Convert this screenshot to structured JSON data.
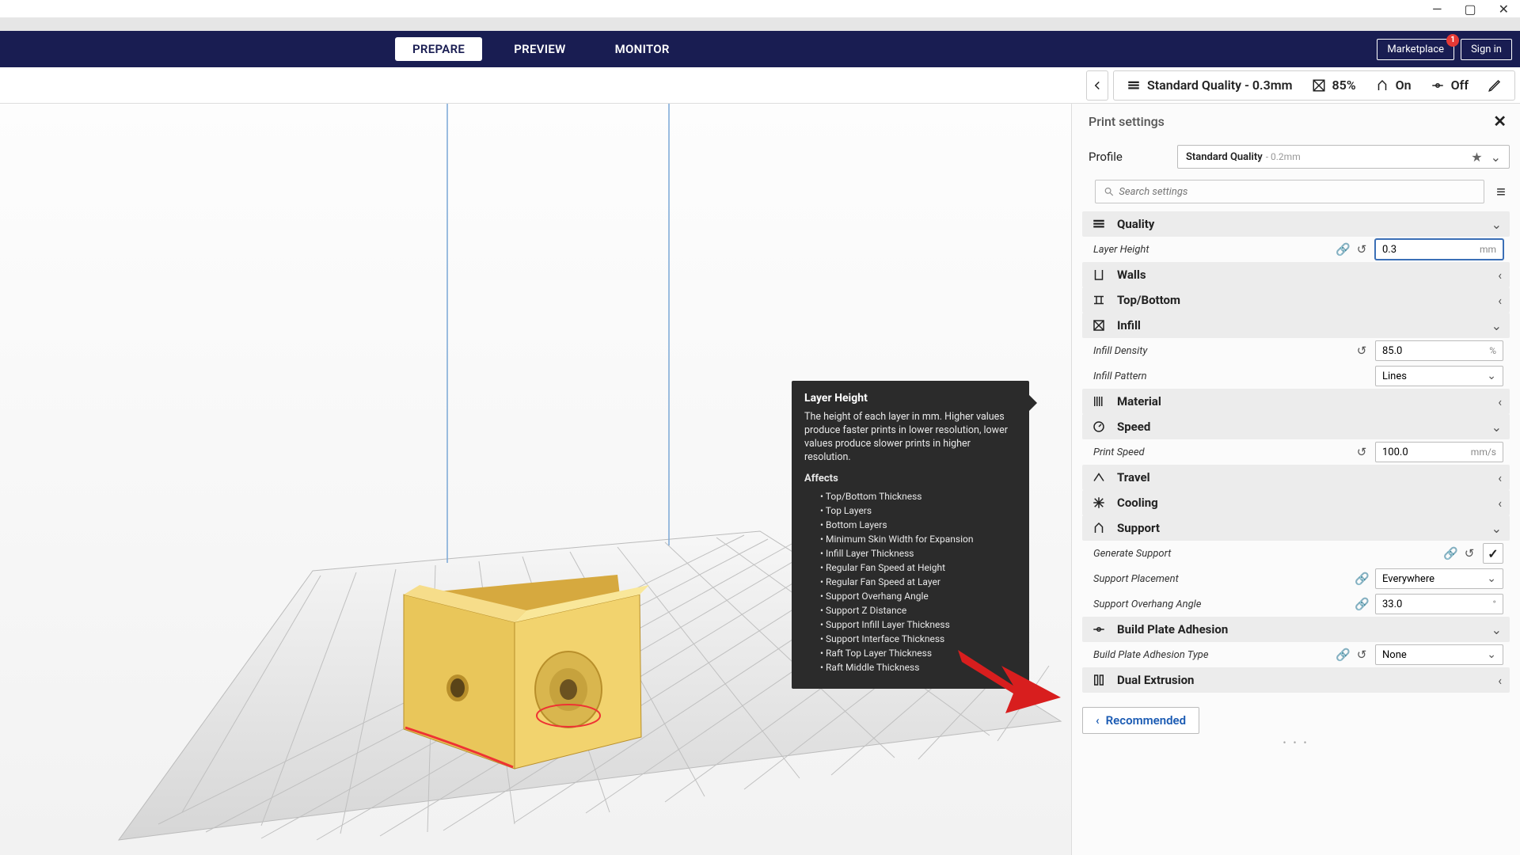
{
  "window": {
    "min": "—",
    "max": "▢",
    "close": "✕"
  },
  "nav": {
    "tabs": [
      "PREPARE",
      "PREVIEW",
      "MONITOR"
    ],
    "active": 0,
    "marketplace": "Marketplace",
    "marketplace_badge": "1",
    "signin": "Sign in"
  },
  "summary": {
    "profile": "Standard Quality - 0.3mm",
    "infill": "85%",
    "support": "On",
    "adhesion": "Off"
  },
  "tooltip": {
    "title": "Layer Height",
    "body": "The height of each layer in mm. Higher values produce faster prints in lower resolution, lower values produce slower prints in higher resolution.",
    "affects_label": "Affects",
    "affects": [
      "Top/Bottom Thickness",
      "Top Layers",
      "Bottom Layers",
      "Minimum Skin Width for Expansion",
      "Infill Layer Thickness",
      "Regular Fan Speed at Height",
      "Regular Fan Speed at Layer",
      "Support Overhang Angle",
      "Support Z Distance",
      "Support Infill Layer Thickness",
      "Support Interface Thickness",
      "Raft Top Layer Thickness",
      "Raft Middle Thickness"
    ]
  },
  "panel": {
    "title": "Print settings",
    "profile_label": "Profile",
    "profile_name": "Standard Quality",
    "profile_sub": " - 0.2mm",
    "search_placeholder": "Search settings",
    "sections": {
      "quality": "Quality",
      "walls": "Walls",
      "topbottom": "Top/Bottom",
      "infill": "Infill",
      "material": "Material",
      "speed": "Speed",
      "travel": "Travel",
      "cooling": "Cooling",
      "support": "Support",
      "adhesion": "Build Plate Adhesion",
      "dual": "Dual Extrusion"
    },
    "settings": {
      "layer_height": {
        "label": "Layer Height",
        "value": "0.3",
        "unit": "mm"
      },
      "infill_density": {
        "label": "Infill Density",
        "value": "85.0",
        "unit": "%"
      },
      "infill_pattern": {
        "label": "Infill Pattern",
        "value": "Lines"
      },
      "print_speed": {
        "label": "Print Speed",
        "value": "100.0",
        "unit": "mm/s"
      },
      "generate_support": {
        "label": "Generate Support",
        "checked": true
      },
      "support_placement": {
        "label": "Support Placement",
        "value": "Everywhere"
      },
      "support_angle": {
        "label": "Support Overhang Angle",
        "value": "33.0",
        "unit": "°"
      },
      "adhesion_type": {
        "label": "Build Plate Adhesion Type",
        "value": "None"
      }
    },
    "recommended": "Recommended"
  }
}
